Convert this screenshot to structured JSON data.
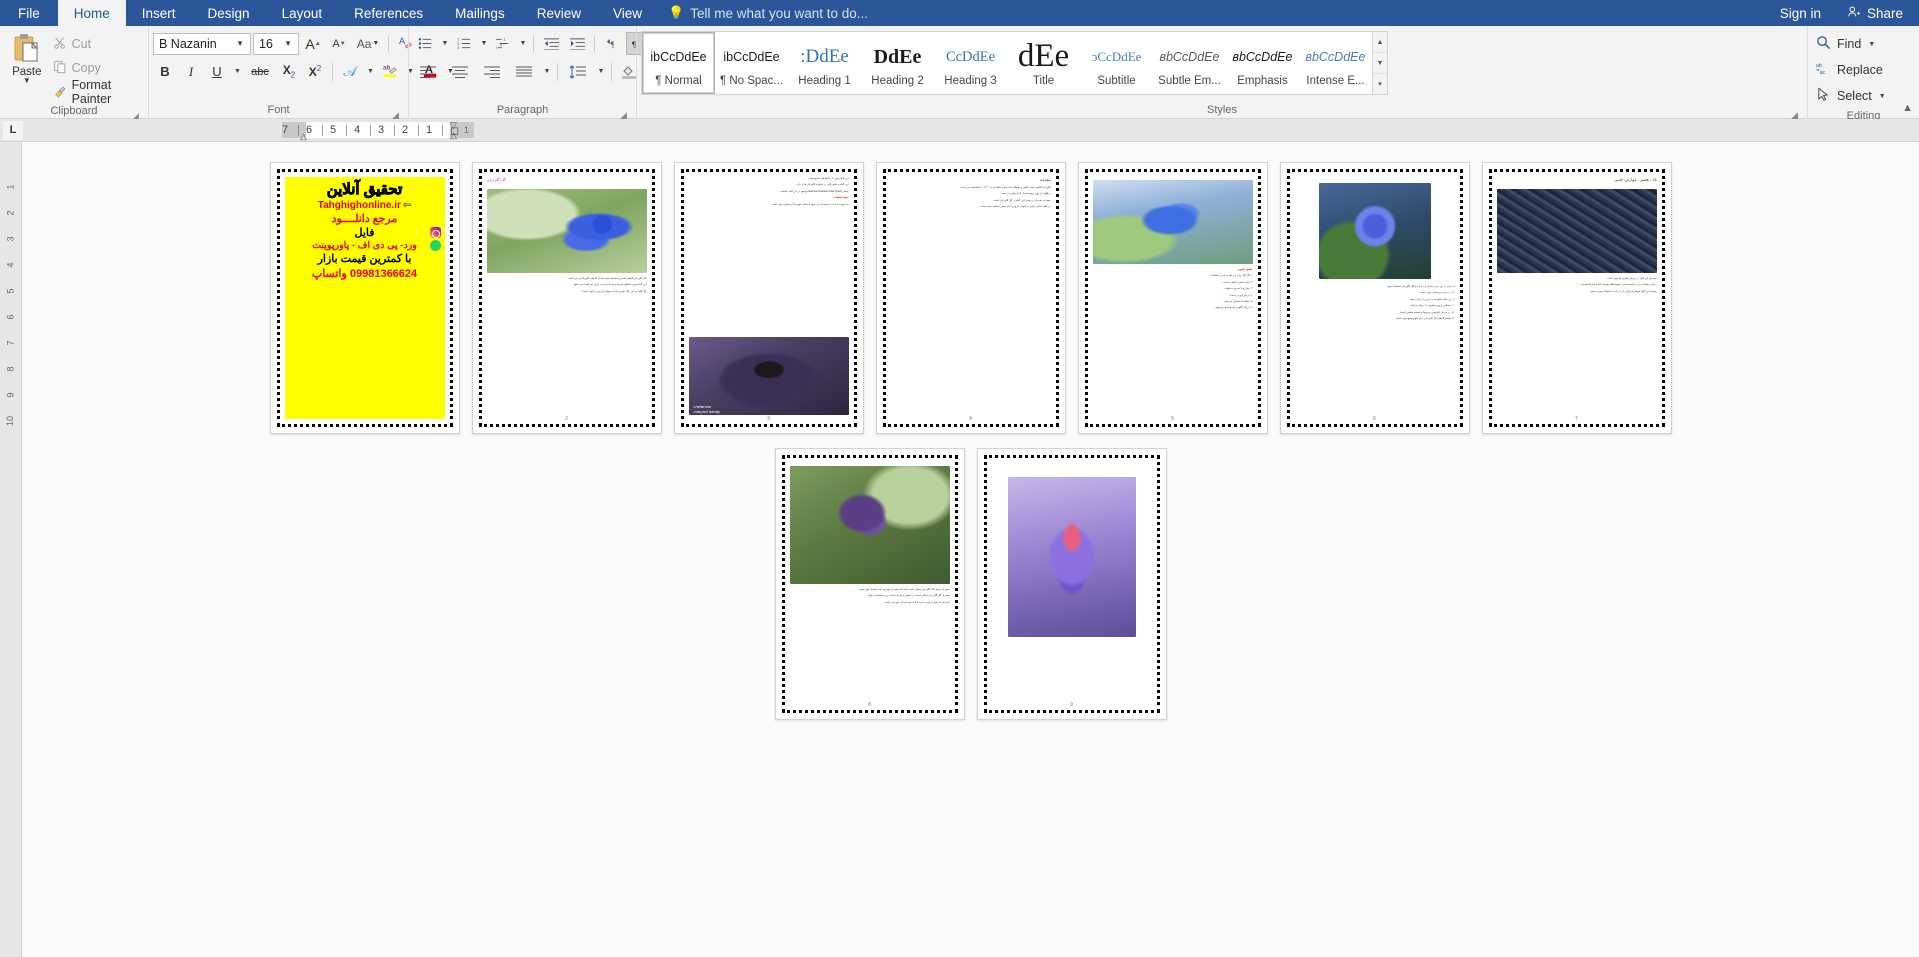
{
  "titlebar": {
    "tabs": [
      {
        "label": "File",
        "id": "file"
      },
      {
        "label": "Home",
        "id": "home"
      },
      {
        "label": "Insert",
        "id": "insert"
      },
      {
        "label": "Design",
        "id": "design"
      },
      {
        "label": "Layout",
        "id": "layout"
      },
      {
        "label": "References",
        "id": "references"
      },
      {
        "label": "Mailings",
        "id": "mailings"
      },
      {
        "label": "Review",
        "id": "review"
      },
      {
        "label": "View",
        "id": "view"
      }
    ],
    "tell_me": "Tell me what you want to do...",
    "sign_in": "Sign in",
    "share": "Share"
  },
  "ribbon": {
    "clipboard": {
      "group_label": "Clipboard",
      "paste_label": "Paste",
      "cut_label": "Cut",
      "copy_label": "Copy",
      "format_painter_label": "Format Painter"
    },
    "font": {
      "group_label": "Font",
      "font_name": "B Nazanin",
      "font_size": "16",
      "grow_font": "A",
      "shrink_font": "A",
      "change_case": "Aa",
      "clear_formatting": "clear-formatting-icon",
      "bold": "B",
      "italic": "I",
      "underline": "U",
      "strikethrough": "abc",
      "subscript": "X2",
      "superscript": "X2",
      "text_effects": "A",
      "highlight": "ab",
      "font_color": "A"
    },
    "paragraph": {
      "group_label": "Paragraph",
      "bullets": "bullets-icon",
      "numbering": "numbering-icon",
      "multilevel": "multilevel-list-icon",
      "decrease_indent": "decrease-indent-icon",
      "increase_indent": "increase-indent-icon",
      "ltr": "left-to-right-icon",
      "rtl": "right-to-left-icon",
      "sort": "sort-icon",
      "show_marks": "show-formatting-marks-icon",
      "align_left": "align-left-icon",
      "align_center": "align-center-icon",
      "align_right": "align-right-icon",
      "justify": "justify-icon",
      "line_spacing": "line-spacing-icon",
      "shading": "shading-icon",
      "borders": "borders-icon"
    },
    "styles": {
      "group_label": "Styles",
      "items": [
        {
          "preview": "ibCcDdEe",
          "name": "¶ Normal",
          "active": true,
          "kind": "normal"
        },
        {
          "preview": "ibCcDdEe",
          "name": "¶ No Spac...",
          "active": false,
          "kind": "nospace"
        },
        {
          "preview": ":DdEe",
          "name": "Heading 1",
          "active": false,
          "kind": "h1"
        },
        {
          "preview": "DdEe",
          "name": "Heading 2",
          "active": false,
          "kind": "h2"
        },
        {
          "preview": "CcDdEe",
          "name": "Heading 3",
          "active": false,
          "kind": "h3"
        },
        {
          "preview": "dEe",
          "name": "Title",
          "active": false,
          "kind": "title"
        },
        {
          "preview": "ɔCcDdEe",
          "name": "Subtitle",
          "active": false,
          "kind": "subtitle"
        },
        {
          "preview": "ʙbCcDdEe",
          "name": "Subtle Em...",
          "active": false,
          "kind": "subtle"
        },
        {
          "preview": "ʙbCcDdEe",
          "name": "Emphasis",
          "active": false,
          "kind": "emphasis"
        },
        {
          "preview": "ʙbCcDdEe",
          "name": "Intense E...",
          "active": false,
          "kind": "intense"
        }
      ]
    },
    "editing": {
      "group_label": "Editing",
      "find_label": "Find",
      "replace_label": "Replace",
      "select_label": "Select"
    },
    "collapse_label": "collapse-ribbon-icon"
  },
  "ruler": {
    "tab_stop": "L",
    "marks": [
      "7",
      "6",
      "5",
      "4",
      "3",
      "2",
      "1",
      "1"
    ],
    "vertical_marks": [
      "1",
      "2",
      "3",
      "4",
      "5",
      "6",
      "7",
      "8",
      "9",
      "10"
    ]
  },
  "document": {
    "pages": [
      {
        "id": "page-1",
        "kind": "promo",
        "number": "1",
        "promo": {
          "title": "تحقیق آنلاین",
          "url": "Tahghighonline.ir",
          "line1": "مرجع دانلــــود",
          "line2": "فایل",
          "line3": "ورد- پی دی اف - پاورپوینت",
          "line4": "با کمترین قیمت بازار",
          "phone": "09981366624 واتساپ",
          "icons": [
            "instagram-icon",
            "whatsapp-icon"
          ]
        }
      },
      {
        "id": "page-2",
        "kind": "text",
        "number": "2",
        "header": "گل گاو زبان",
        "photo": "photo-a",
        "body": [
          "گل گاو زبان گیاهی علفی و یکساله است که از خانواده گاوزبانیان می باشد.",
          "این گیاه بومی مناطق مدیترانه ای است و در ایران نیز کشت می شود.",
          "گل های آن آبی رنگ بوده و دارای خواص دارویی فراوان است."
        ]
      },
      {
        "id": "page-3",
        "kind": "text",
        "number": "3",
        "header": "این گیاه بومی از خانوادهی منابع است",
        "photo": "photo-b",
        "caption": "chefarmin",
        "caption2": "maryam bandy",
        "body": [
          "این گیاه به طور کلی در خانواده گاوزبان قرار دارد.",
          "مقدار Gamma Linolenic Acid (GLA) موجود در این گیاه بالاست.",
          "نحوه استفاده :",
          "به صورت دم کرده مصرف می شود و بیشتر جهت آرام بخشی موثر است."
        ]
      },
      {
        "id": "page-4",
        "kind": "text",
        "number": "4",
        "header": "مقدمه",
        "body": [
          "گاوزبان گیاهی است علفی و یکساله که ارتفاع ساقه آن به ۳۰ تا ۷۰ سانتیمتر می رسد.",
          "برگهای آن پهن و پوشیده از کرک های زبر است.",
          "مصرف شربت آن سنتی این گیاه در گل گاو زبان است.",
          "در طب سنتی ایران به عنوان دارویی آرام بخش شناخته شده است."
        ]
      },
      {
        "id": "page-5",
        "kind": "text",
        "number": "5",
        "photo": "photo-c",
        "header": "خواص دارویی",
        "body": [
          "۱. گل گاو زبان و برطرف کردن اضطراب",
          "۲. آرام بخشی اعصاب است.",
          "۳. مبارزه با تعریق مرطوب.",
          "۴. درمان آوردن است.",
          "۵. مقابله با تسکین می‌شود.",
          "۶. درمان گلودرد ای بیماری می‌شود."
        ]
      },
      {
        "id": "page-6",
        "kind": "text",
        "number": "6",
        "photo": "photo-d",
        "body": [
          "۷. برای از بین بردن سرفه از دم کرده گل گاو زبان استفاده شود.",
          "۸. در درمان پروستات موثر است.",
          "۹. می تواند مانع جذب دارو را درمان برفت.",
          "۱۰. تسکین و ورم ضمیمه را درمان می‌کند.",
          "۱۱. در درمان کم‌خونی مربوط و تصفیه طبیعی است.",
          "۱۲. هضم گیاهان گل گاو زبان برای بلوغ وضع موثر است."
        ]
      },
      {
        "id": "page-7",
        "kind": "text",
        "number": "7",
        "photo": "photo-e",
        "header": "۱۵ - هضم - عوارض جانبی",
        "body": [
          "مقدمار این گیاه در درمان بیماری ها موثر است.",
          "دمبل و خشک نیز در شیمیدرمانی عفونت‌های پوست اماده آنتی‌اکسیدانت.",
          "پوسته این گیاه خواص فراوان دارد و باید با احتیاط مصرف شود."
        ]
      },
      {
        "id": "page-8",
        "kind": "text",
        "number": "8",
        "photo": "photo-f",
        "body": [
          "مصرف زیادی گل گاو زبان ممکن است باعث افزایش و عوارض شدن فشار خون شود.",
          "مصرف گل گاو زبان ممکن است در بعضی از افراد باعث بروز حساسیت شود.",
          "افرادی که بیماری کبدی دارند باید از مصرف آن خودداری کنند."
        ]
      },
      {
        "id": "page-9",
        "kind": "text",
        "number": "9",
        "photo": "photo-g",
        "body": []
      }
    ]
  }
}
